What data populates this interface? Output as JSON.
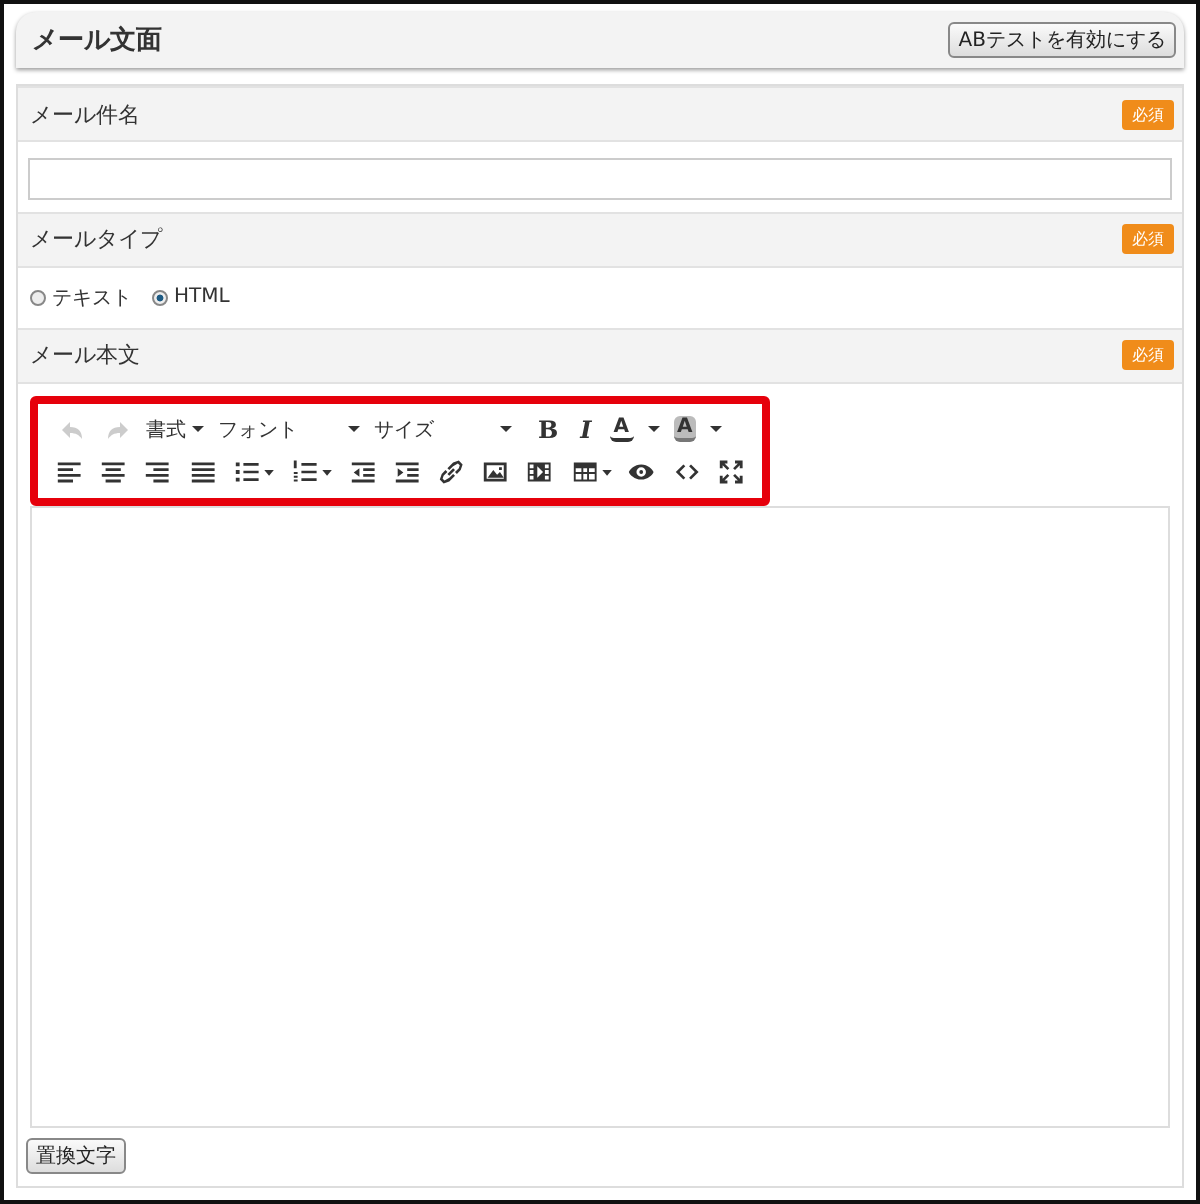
{
  "header": {
    "title": "メール文面",
    "ab_button": "ABテストを有効にする"
  },
  "subject": {
    "label": "メール件名",
    "badge": "必須"
  },
  "mail_type": {
    "label": "メールタイプ",
    "badge": "必須",
    "options": [
      {
        "label": "テキスト",
        "selected": false
      },
      {
        "label": "HTML",
        "selected": true
      }
    ]
  },
  "body": {
    "label": "メール本文",
    "badge": "必須",
    "toolbar": {
      "undo": {
        "disabled": true
      },
      "redo": {
        "disabled": true
      },
      "dropdowns": [
        "書式",
        "フォント",
        "サイズ"
      ],
      "bold": "B",
      "italic": "I",
      "text_color": "A",
      "bg_color": "A"
    },
    "insert_button": "置換文字"
  }
}
